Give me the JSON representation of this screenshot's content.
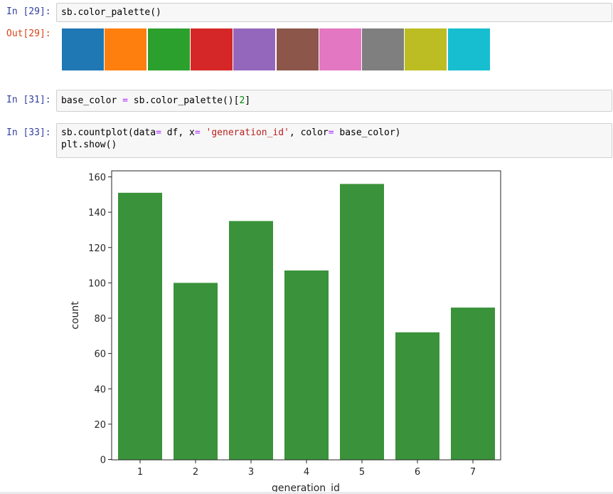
{
  "cells": [
    {
      "prompt": "In [29]:",
      "code": "sb.color_palette()",
      "output_prompt": "Out[29]:",
      "palette": [
        "#1f77b4",
        "#ff7f0e",
        "#2ca02c",
        "#d62728",
        "#9467bd",
        "#8c564b",
        "#e377c2",
        "#7f7f7f",
        "#bcbd22",
        "#17becf"
      ]
    },
    {
      "prompt": "In [31]:",
      "code_parts": [
        "base_color ",
        "=",
        " sb.color_palette()[",
        "2",
        "]"
      ]
    },
    {
      "prompt": "In [33]:",
      "code_line1_parts": [
        "sb.countplot(data",
        "=",
        " df, x",
        "=",
        " ",
        "'generation_id'",
        ", color",
        "=",
        " base_color)"
      ],
      "code_line2": "plt.show()"
    }
  ],
  "chart_data": {
    "type": "bar",
    "categories": [
      "1",
      "2",
      "3",
      "4",
      "5",
      "6",
      "7"
    ],
    "values": [
      151,
      100,
      135,
      107,
      156,
      72,
      86
    ],
    "xlabel": "generation_id",
    "ylabel": "count",
    "ylim": [
      0,
      160
    ],
    "yticks": [
      0,
      20,
      40,
      60,
      80,
      100,
      120,
      140,
      160
    ],
    "bar_color": "#3a923a",
    "grid": false
  }
}
